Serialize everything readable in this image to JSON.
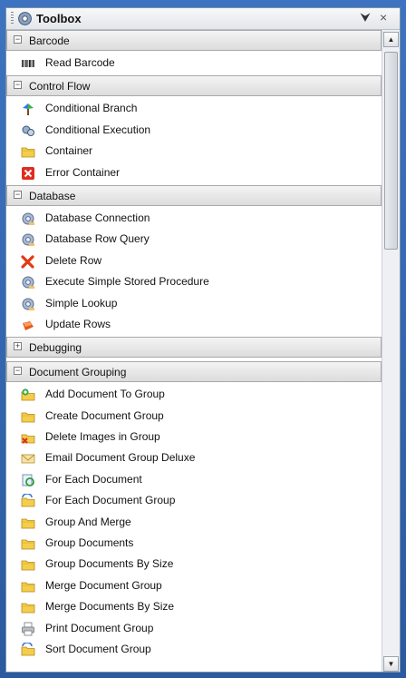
{
  "window": {
    "title": "Toolbox",
    "pin_glyph": "⮟",
    "close_glyph": "×"
  },
  "categories": [
    {
      "label": "Barcode",
      "expanded": true,
      "items": [
        {
          "label": "Read Barcode",
          "icon": "barcode-icon"
        }
      ]
    },
    {
      "label": "Control Flow",
      "expanded": true,
      "items": [
        {
          "label": "Conditional Branch",
          "icon": "branch-icon"
        },
        {
          "label": "Conditional Execution",
          "icon": "conditional-execution-icon"
        },
        {
          "label": "Container",
          "icon": "folder-icon"
        },
        {
          "label": "Error Container",
          "icon": "error-icon"
        }
      ]
    },
    {
      "label": "Database",
      "expanded": true,
      "items": [
        {
          "label": "Database Connection",
          "icon": "database-gear-icon"
        },
        {
          "label": "Database Row Query",
          "icon": "database-gear-icon"
        },
        {
          "label": "Delete Row",
          "icon": "delete-icon"
        },
        {
          "label": "Execute Simple Stored Procedure",
          "icon": "database-gear-icon"
        },
        {
          "label": "Simple Lookup",
          "icon": "database-gear-icon"
        },
        {
          "label": "Update Rows",
          "icon": "update-icon"
        }
      ]
    },
    {
      "label": "Debugging",
      "expanded": false,
      "items": []
    },
    {
      "label": "Document Grouping",
      "expanded": true,
      "items": [
        {
          "label": "Add Document To Group",
          "icon": "add-folder-icon"
        },
        {
          "label": "Create Document Group",
          "icon": "folder-icon"
        },
        {
          "label": "Delete Images in Group",
          "icon": "delete-folder-icon"
        },
        {
          "label": "Email Document Group Deluxe",
          "icon": "envelope-icon"
        },
        {
          "label": "For Each Document",
          "icon": "loop-icon"
        },
        {
          "label": "For Each Document Group",
          "icon": "folder-loop-icon"
        },
        {
          "label": "Group And Merge",
          "icon": "folder-icon"
        },
        {
          "label": "Group Documents",
          "icon": "folder-icon"
        },
        {
          "label": "Group Documents By Size",
          "icon": "folder-icon"
        },
        {
          "label": "Merge Document Group",
          "icon": "folder-icon"
        },
        {
          "label": "Merge Documents By Size",
          "icon": "folder-icon"
        },
        {
          "label": "Print Document Group",
          "icon": "printer-icon"
        },
        {
          "label": "Sort Document Group",
          "icon": "folder-loop-icon"
        }
      ]
    }
  ],
  "colors": {
    "frame": "#2f62a9",
    "category_bg": "#e6e6e6"
  }
}
